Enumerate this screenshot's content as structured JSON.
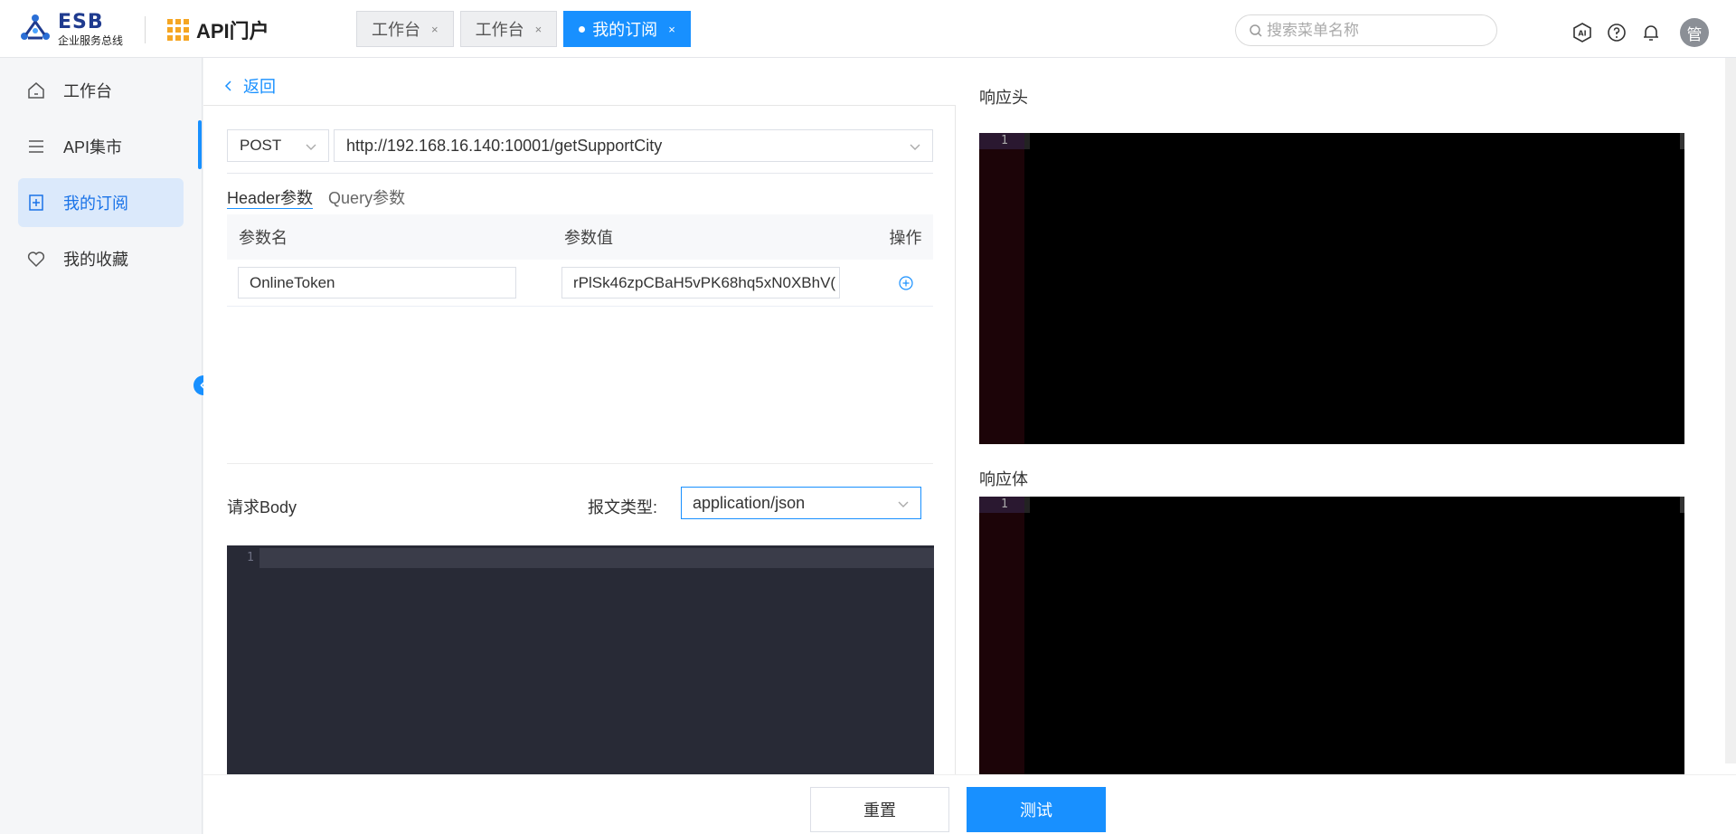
{
  "header": {
    "logo_title": "ESB",
    "logo_subtitle": "企业服务总线",
    "portal_title": "API门户",
    "tabs": [
      {
        "label": "工作台",
        "close": "×"
      },
      {
        "label": "工作台",
        "close": "×"
      },
      {
        "label": "我的订阅",
        "close": "×",
        "active": true
      }
    ],
    "search_placeholder": "搜索菜单名称",
    "avatar_text": "管",
    "icons": [
      "ai-icon",
      "help-icon",
      "bell-icon"
    ]
  },
  "sidebar": {
    "items": [
      {
        "label": "工作台",
        "icon": "home-icon"
      },
      {
        "label": "API集市",
        "icon": "menu-icon"
      },
      {
        "label": "我的订阅",
        "icon": "subscribe-icon",
        "active": true
      },
      {
        "label": "我的收藏",
        "icon": "heart-icon"
      }
    ]
  },
  "main": {
    "back_label": "返回",
    "method": "POST",
    "url": "http://192.168.16.140:10001/getSupportCity",
    "param_tabs": [
      {
        "label": "Header参数",
        "active": true
      },
      {
        "label": "Query参数"
      }
    ],
    "table": {
      "columns": [
        "参数名",
        "参数值",
        "操作"
      ],
      "rows": [
        {
          "name": "OnlineToken",
          "value": "rPlSk46zpCBaH5vPK68hq5xN0XBhV("
        }
      ]
    },
    "body_label": "请求Body",
    "message_type_label": "报文类型:",
    "message_type_value": "application/json",
    "request_editor_line": "1",
    "response_header_label": "响应头",
    "response_body_label": "响应体",
    "response_header_line": "1",
    "response_body_line": "1"
  },
  "footer": {
    "reset_label": "重置",
    "test_label": "测试"
  },
  "colors": {
    "accent": "#1890ff",
    "editor_bg": "#282a36",
    "response_bg": "#000000"
  }
}
